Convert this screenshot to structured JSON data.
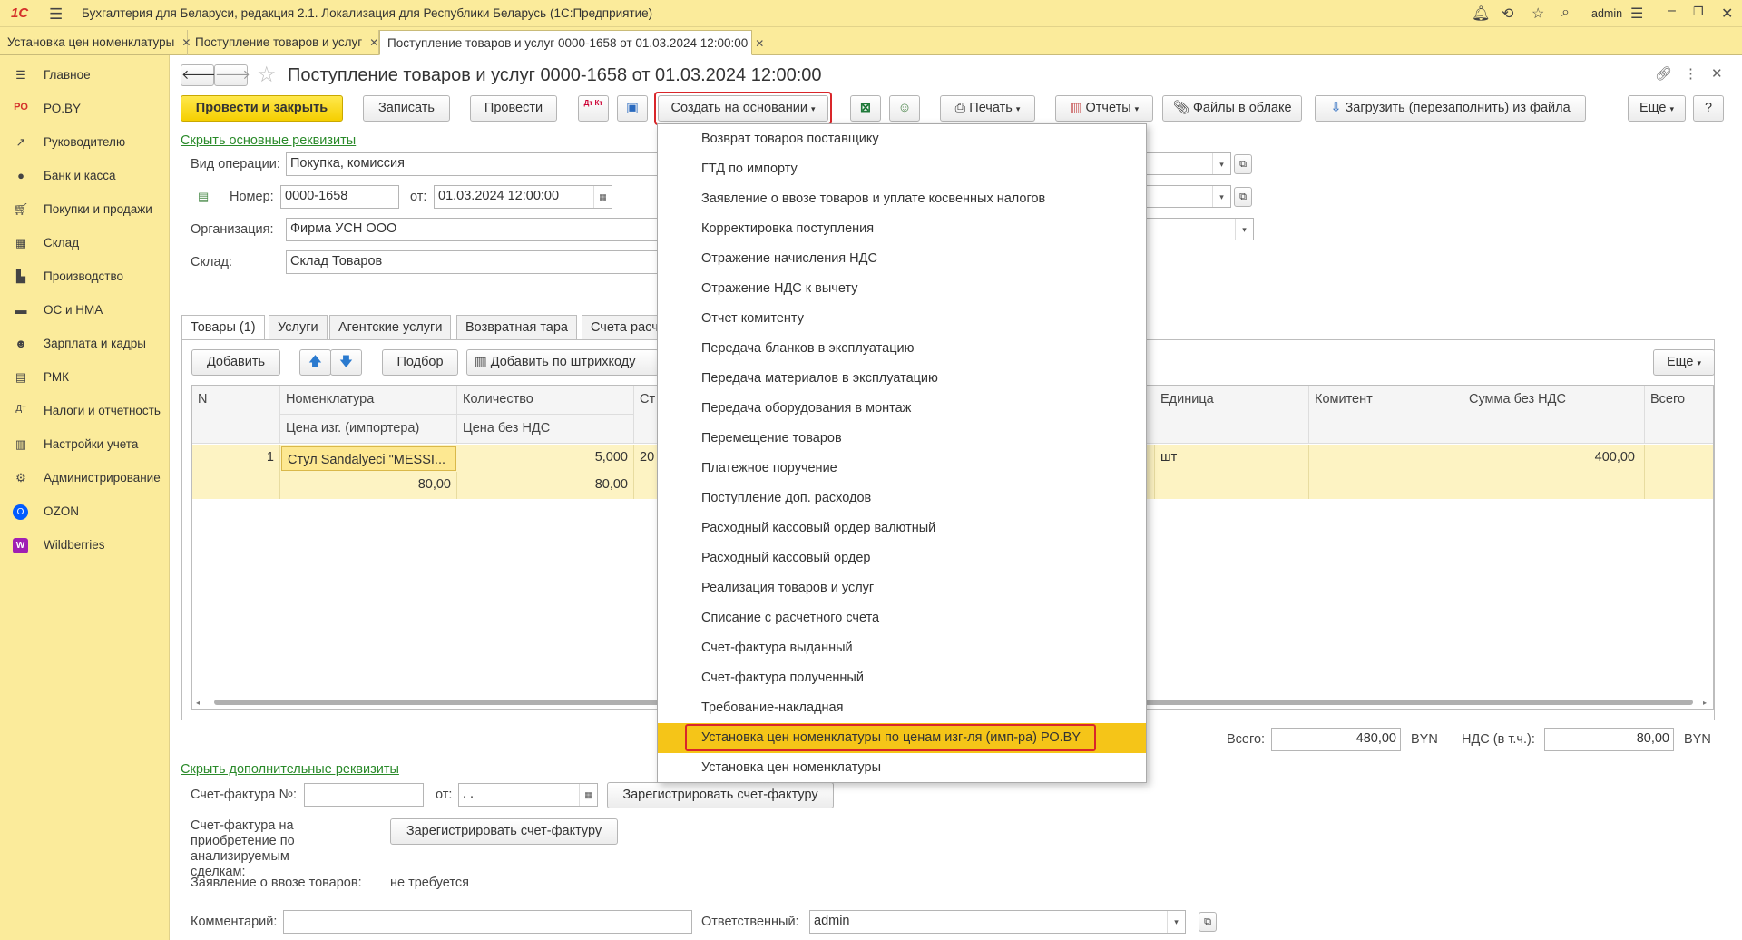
{
  "app": {
    "logo": "1С",
    "title": "Бухгалтерия для Беларуси, редакция 2.1. Локализация для Республики Беларусь   (1С:Предприятие)",
    "user": "admin"
  },
  "open_tabs": [
    {
      "label": "Установка цен номенклатуры"
    },
    {
      "label": "Поступление товаров и услуг"
    },
    {
      "label": "Поступление товаров и услуг 0000-1658 от 01.03.2024 12:00:00"
    }
  ],
  "sidebar": {
    "items": [
      {
        "label": "Главное",
        "icon": "menu-icon"
      },
      {
        "label": "РО.BY",
        "icon": "ro-icon"
      },
      {
        "label": "Руководителю",
        "icon": "chart-icon"
      },
      {
        "label": "Банк и касса",
        "icon": "bank-icon"
      },
      {
        "label": "Покупки и продажи",
        "icon": "cart-icon"
      },
      {
        "label": "Склад",
        "icon": "warehouse-icon"
      },
      {
        "label": "Производство",
        "icon": "factory-icon"
      },
      {
        "label": "ОС и НМА",
        "icon": "truck-icon"
      },
      {
        "label": "Зарплата и кадры",
        "icon": "people-icon"
      },
      {
        "label": "РМК",
        "icon": "register-icon"
      },
      {
        "label": "Налоги и отчетность",
        "icon": "tax-icon"
      },
      {
        "label": "Настройки учета",
        "icon": "settings-doc-icon"
      },
      {
        "label": "Администрирование",
        "icon": "gear-icon"
      },
      {
        "label": "OZON",
        "icon": "ozon-icon"
      },
      {
        "label": "Wildberries",
        "icon": "wb-icon"
      }
    ]
  },
  "doc": {
    "title": "Поступление товаров и услуг 0000-1658 от 01.03.2024 12:00:00",
    "toolbar": {
      "post_close": "Провести и закрыть",
      "save": "Записать",
      "post": "Провести",
      "dtkt": "Дт Кт",
      "create_based": "Создать на основании",
      "print": "Печать",
      "reports": "Отчеты",
      "cloud_files": "Файлы в облаке",
      "load_file": "Загрузить (перезаполнить) из файла",
      "more": "Еще",
      "help": "?"
    },
    "hide_main_link": "Скрыть основные реквизиты",
    "fields": {
      "operation_label": "Вид операции:",
      "operation_value": "Покупка, комиссия",
      "number_label": "Номер:",
      "number_value": "0000-1658",
      "from_label": "от:",
      "date_value": "01.03.2024 12:00:00",
      "org_label": "Организация:",
      "org_value": "Фирма УСН ООО",
      "warehouse_label": "Склад:",
      "warehouse_value": "Склад Товаров"
    },
    "tabs": [
      "Товары (1)",
      "Услуги",
      "Агентские услуги",
      "Возвратная тара",
      "Счета расч"
    ],
    "grid_toolbar": {
      "add": "Добавить",
      "select": "Подбор",
      "add_barcode": "Добавить по штрихкоду",
      "more": "Еще"
    },
    "grid": {
      "headers": {
        "n": "N",
        "nomenclature": "Номенклатура",
        "nomenclature_sub": "Цена изг. (импортера)",
        "qty": "Количество",
        "qty_sub": "Цена без НДС",
        "st": "Ст",
        "unit": "Единица",
        "committent": "Комитент",
        "sum_no_vat": "Сумма без НДС",
        "total": "Всего"
      },
      "rows": [
        {
          "n": "1",
          "nomenclature": "Стул Sandalyeci \"MESSI...",
          "mfr_price": "80,00",
          "qty": "5,000",
          "price": "80,00",
          "st": "20",
          "unit": "шт",
          "committent": "",
          "sum_no_vat": "400,00",
          "total": ""
        }
      ]
    },
    "totals": {
      "total_label": "Всего:",
      "total_value": "480,00",
      "currency": "BYN",
      "vat_label": "НДС (в т.ч.):",
      "vat_value": "80,00"
    },
    "extra_link": "Скрыть дополнительные реквизиты",
    "invoice": {
      "label": "Счет-фактура №:",
      "number": "",
      "from_label": "от:",
      "date": " .  .",
      "register": "Зарегистрировать счет-фактуру",
      "purchase_label": "Счет-фактура на приобретение по анализируемым сделкам:",
      "register2": "Зарегистрировать счет-фактуру",
      "import_label": "Заявление о ввозе товаров:",
      "import_value": "не требуется"
    },
    "comment_label": "Комментарий:",
    "comment_value": "",
    "responsible_label": "Ответственный:",
    "responsible_value": "admin"
  },
  "dropdown_menu": {
    "items": [
      "Возврат товаров поставщику",
      "ГТД по импорту",
      "Заявление о ввозе товаров и уплате косвенных налогов",
      "Корректировка поступления",
      "Отражение начисления НДС",
      "Отражение НДС к вычету",
      "Отчет комитенту",
      "Передача бланков в эксплуатацию",
      "Передача материалов в эксплуатацию",
      "Передача оборудования в монтаж",
      "Перемещение товаров",
      "Платежное поручение",
      "Поступление доп. расходов",
      "Расходный кассовый ордер валютный",
      "Расходный кассовый ордер",
      "Реализация товаров и услуг",
      "Списание с расчетного счета",
      "Счет-фактура выданный",
      "Счет-фактура полученный",
      "Требование-накладная",
      "Установка цен номенклатуры по ценам изг-ля (имп-ра) РО.BY",
      "Установка цен номенклатуры"
    ],
    "selected_index": 20
  },
  "colors": {
    "accent_yellow": "#fbeb9b",
    "selection": "#f5c518",
    "highlight_border": "#d9262a",
    "link_green": "#2a8a2a"
  }
}
